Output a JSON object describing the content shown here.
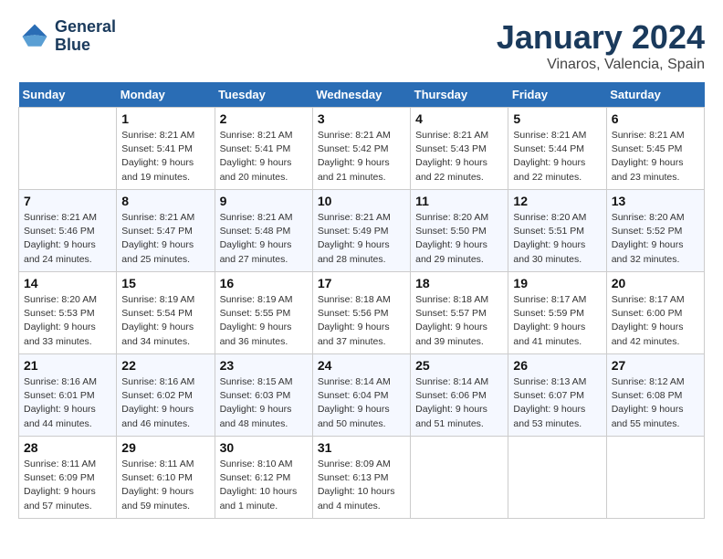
{
  "header": {
    "logo_line1": "General",
    "logo_line2": "Blue",
    "month": "January 2024",
    "location": "Vinaros, Valencia, Spain"
  },
  "weekdays": [
    "Sunday",
    "Monday",
    "Tuesday",
    "Wednesday",
    "Thursday",
    "Friday",
    "Saturday"
  ],
  "weeks": [
    [
      {
        "day": "",
        "sunrise": "",
        "sunset": "",
        "daylight": ""
      },
      {
        "day": "1",
        "sunrise": "Sunrise: 8:21 AM",
        "sunset": "Sunset: 5:41 PM",
        "daylight": "Daylight: 9 hours and 19 minutes."
      },
      {
        "day": "2",
        "sunrise": "Sunrise: 8:21 AM",
        "sunset": "Sunset: 5:41 PM",
        "daylight": "Daylight: 9 hours and 20 minutes."
      },
      {
        "day": "3",
        "sunrise": "Sunrise: 8:21 AM",
        "sunset": "Sunset: 5:42 PM",
        "daylight": "Daylight: 9 hours and 21 minutes."
      },
      {
        "day": "4",
        "sunrise": "Sunrise: 8:21 AM",
        "sunset": "Sunset: 5:43 PM",
        "daylight": "Daylight: 9 hours and 22 minutes."
      },
      {
        "day": "5",
        "sunrise": "Sunrise: 8:21 AM",
        "sunset": "Sunset: 5:44 PM",
        "daylight": "Daylight: 9 hours and 22 minutes."
      },
      {
        "day": "6",
        "sunrise": "Sunrise: 8:21 AM",
        "sunset": "Sunset: 5:45 PM",
        "daylight": "Daylight: 9 hours and 23 minutes."
      }
    ],
    [
      {
        "day": "7",
        "sunrise": "Sunrise: 8:21 AM",
        "sunset": "Sunset: 5:46 PM",
        "daylight": "Daylight: 9 hours and 24 minutes."
      },
      {
        "day": "8",
        "sunrise": "Sunrise: 8:21 AM",
        "sunset": "Sunset: 5:47 PM",
        "daylight": "Daylight: 9 hours and 25 minutes."
      },
      {
        "day": "9",
        "sunrise": "Sunrise: 8:21 AM",
        "sunset": "Sunset: 5:48 PM",
        "daylight": "Daylight: 9 hours and 27 minutes."
      },
      {
        "day": "10",
        "sunrise": "Sunrise: 8:21 AM",
        "sunset": "Sunset: 5:49 PM",
        "daylight": "Daylight: 9 hours and 28 minutes."
      },
      {
        "day": "11",
        "sunrise": "Sunrise: 8:20 AM",
        "sunset": "Sunset: 5:50 PM",
        "daylight": "Daylight: 9 hours and 29 minutes."
      },
      {
        "day": "12",
        "sunrise": "Sunrise: 8:20 AM",
        "sunset": "Sunset: 5:51 PM",
        "daylight": "Daylight: 9 hours and 30 minutes."
      },
      {
        "day": "13",
        "sunrise": "Sunrise: 8:20 AM",
        "sunset": "Sunset: 5:52 PM",
        "daylight": "Daylight: 9 hours and 32 minutes."
      }
    ],
    [
      {
        "day": "14",
        "sunrise": "Sunrise: 8:20 AM",
        "sunset": "Sunset: 5:53 PM",
        "daylight": "Daylight: 9 hours and 33 minutes."
      },
      {
        "day": "15",
        "sunrise": "Sunrise: 8:19 AM",
        "sunset": "Sunset: 5:54 PM",
        "daylight": "Daylight: 9 hours and 34 minutes."
      },
      {
        "day": "16",
        "sunrise": "Sunrise: 8:19 AM",
        "sunset": "Sunset: 5:55 PM",
        "daylight": "Daylight: 9 hours and 36 minutes."
      },
      {
        "day": "17",
        "sunrise": "Sunrise: 8:18 AM",
        "sunset": "Sunset: 5:56 PM",
        "daylight": "Daylight: 9 hours and 37 minutes."
      },
      {
        "day": "18",
        "sunrise": "Sunrise: 8:18 AM",
        "sunset": "Sunset: 5:57 PM",
        "daylight": "Daylight: 9 hours and 39 minutes."
      },
      {
        "day": "19",
        "sunrise": "Sunrise: 8:17 AM",
        "sunset": "Sunset: 5:59 PM",
        "daylight": "Daylight: 9 hours and 41 minutes."
      },
      {
        "day": "20",
        "sunrise": "Sunrise: 8:17 AM",
        "sunset": "Sunset: 6:00 PM",
        "daylight": "Daylight: 9 hours and 42 minutes."
      }
    ],
    [
      {
        "day": "21",
        "sunrise": "Sunrise: 8:16 AM",
        "sunset": "Sunset: 6:01 PM",
        "daylight": "Daylight: 9 hours and 44 minutes."
      },
      {
        "day": "22",
        "sunrise": "Sunrise: 8:16 AM",
        "sunset": "Sunset: 6:02 PM",
        "daylight": "Daylight: 9 hours and 46 minutes."
      },
      {
        "day": "23",
        "sunrise": "Sunrise: 8:15 AM",
        "sunset": "Sunset: 6:03 PM",
        "daylight": "Daylight: 9 hours and 48 minutes."
      },
      {
        "day": "24",
        "sunrise": "Sunrise: 8:14 AM",
        "sunset": "Sunset: 6:04 PM",
        "daylight": "Daylight: 9 hours and 50 minutes."
      },
      {
        "day": "25",
        "sunrise": "Sunrise: 8:14 AM",
        "sunset": "Sunset: 6:06 PM",
        "daylight": "Daylight: 9 hours and 51 minutes."
      },
      {
        "day": "26",
        "sunrise": "Sunrise: 8:13 AM",
        "sunset": "Sunset: 6:07 PM",
        "daylight": "Daylight: 9 hours and 53 minutes."
      },
      {
        "day": "27",
        "sunrise": "Sunrise: 8:12 AM",
        "sunset": "Sunset: 6:08 PM",
        "daylight": "Daylight: 9 hours and 55 minutes."
      }
    ],
    [
      {
        "day": "28",
        "sunrise": "Sunrise: 8:11 AM",
        "sunset": "Sunset: 6:09 PM",
        "daylight": "Daylight: 9 hours and 57 minutes."
      },
      {
        "day": "29",
        "sunrise": "Sunrise: 8:11 AM",
        "sunset": "Sunset: 6:10 PM",
        "daylight": "Daylight: 9 hours and 59 minutes."
      },
      {
        "day": "30",
        "sunrise": "Sunrise: 8:10 AM",
        "sunset": "Sunset: 6:12 PM",
        "daylight": "Daylight: 10 hours and 1 minute."
      },
      {
        "day": "31",
        "sunrise": "Sunrise: 8:09 AM",
        "sunset": "Sunset: 6:13 PM",
        "daylight": "Daylight: 10 hours and 4 minutes."
      },
      {
        "day": "",
        "sunrise": "",
        "sunset": "",
        "daylight": ""
      },
      {
        "day": "",
        "sunrise": "",
        "sunset": "",
        "daylight": ""
      },
      {
        "day": "",
        "sunrise": "",
        "sunset": "",
        "daylight": ""
      }
    ]
  ]
}
